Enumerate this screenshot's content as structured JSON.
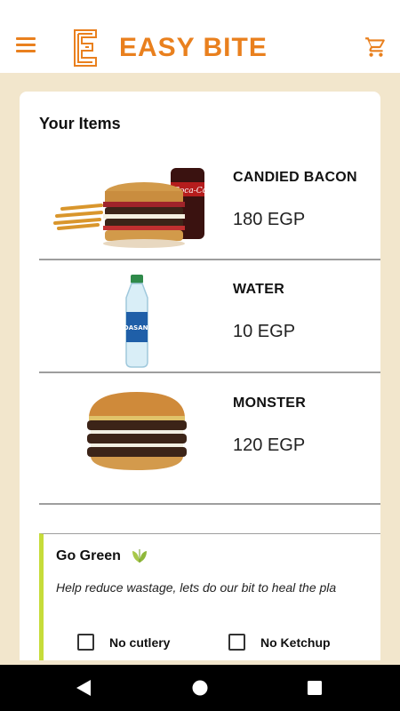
{
  "header": {
    "brand_name": "EASY BITE",
    "brand_color": "#e9801e",
    "menu_icon": "hamburger-menu-icon",
    "cart_icon": "shopping-cart-icon"
  },
  "cart": {
    "title": "Your Items",
    "items": [
      {
        "name": "CANDIED BACON",
        "price": "180 EGP",
        "image": "burger-combo-with-fries-and-cola"
      },
      {
        "name": "WATER",
        "price": "10 EGP",
        "image": "water-bottle"
      },
      {
        "name": "MONSTER",
        "price": "120 EGP",
        "image": "triple-patty-burger"
      }
    ]
  },
  "go_green": {
    "title": "Go Green",
    "icon": "leaf-icon",
    "accent_color": "#c6dc3a",
    "description": "Help reduce wastage, lets do our bit to heal the pla",
    "options": [
      {
        "label": "No cutlery",
        "checked": false
      },
      {
        "label": "No Ketchup",
        "checked": false
      }
    ]
  },
  "system_nav": {
    "back_icon": "back-triangle-icon",
    "home_icon": "home-circle-icon",
    "recents_icon": "recents-square-icon"
  }
}
